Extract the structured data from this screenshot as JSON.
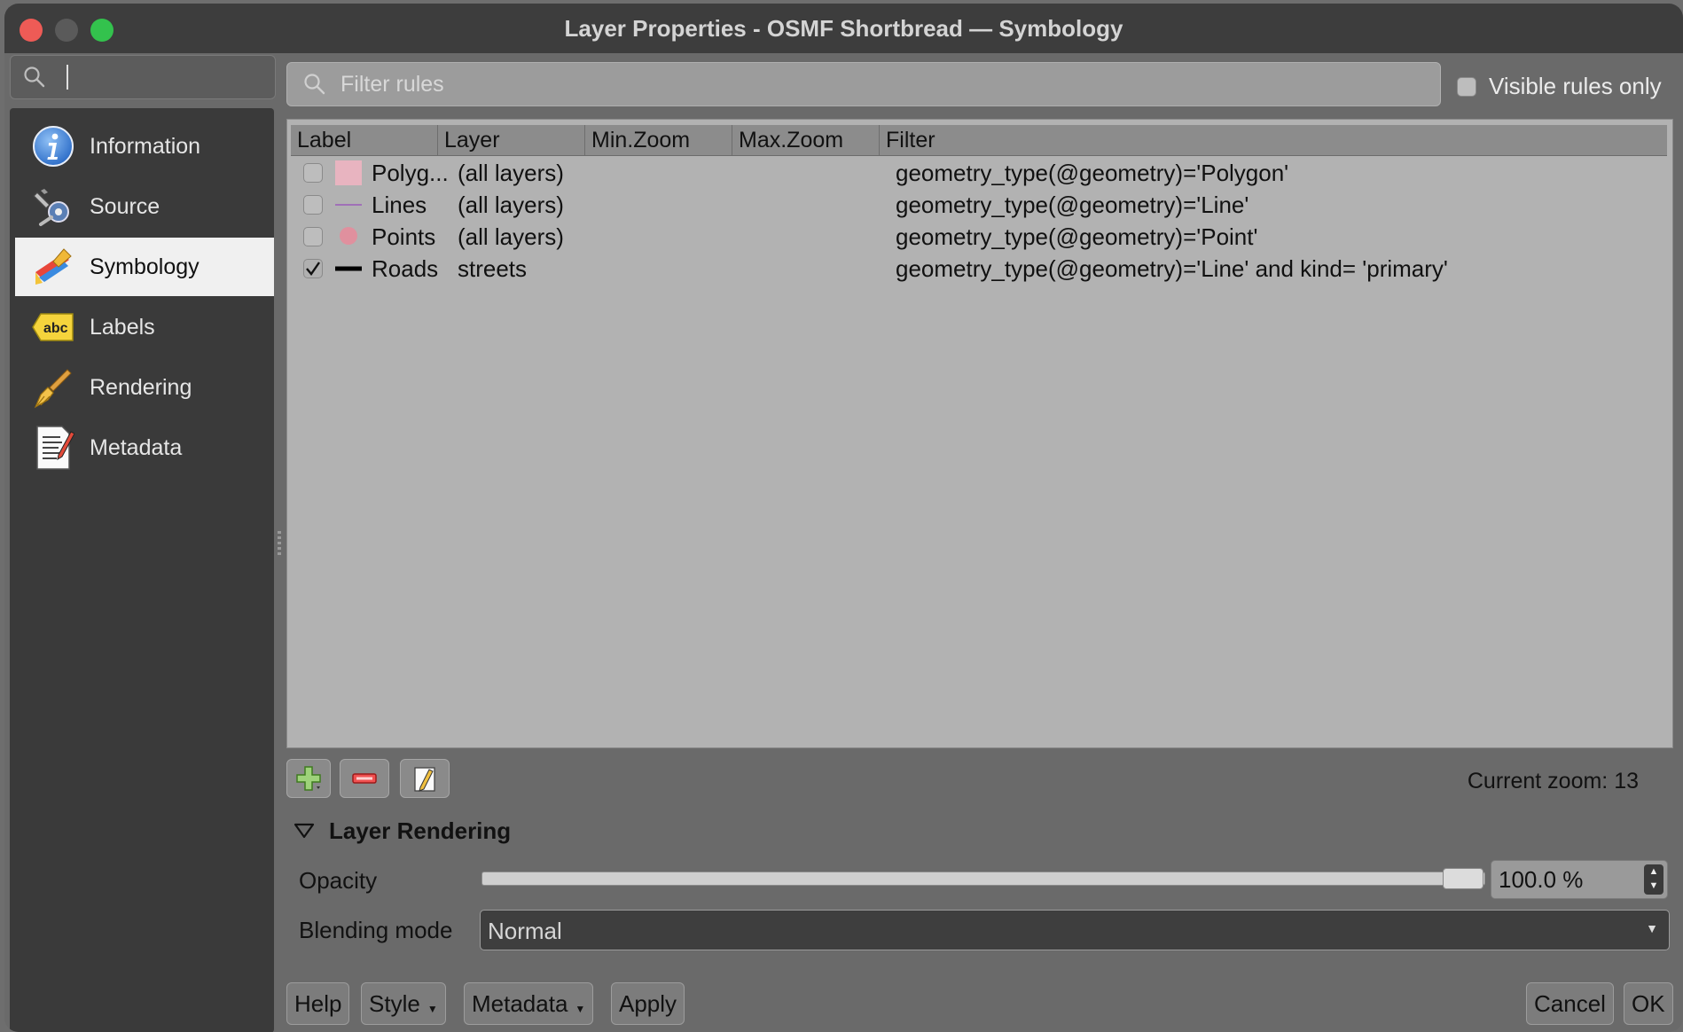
{
  "window": {
    "title": "Layer Properties - OSMF Shortbread — Symbology"
  },
  "sidebar": {
    "search_value": "",
    "items": [
      {
        "label": "Information",
        "icon": "info-icon",
        "active": false
      },
      {
        "label": "Source",
        "icon": "source-icon",
        "active": false
      },
      {
        "label": "Symbology",
        "icon": "symbology-icon",
        "active": true
      },
      {
        "label": "Labels",
        "icon": "labels-icon",
        "active": false
      },
      {
        "label": "Rendering",
        "icon": "rendering-icon",
        "active": false
      },
      {
        "label": "Metadata",
        "icon": "metadata-icon",
        "active": false
      }
    ]
  },
  "filter": {
    "placeholder": "Filter rules",
    "visible_rules_only": "Visible rules only",
    "visible_rules_checked": false
  },
  "table": {
    "columns": [
      "Label",
      "Layer",
      "Min.Zoom",
      "Max.Zoom",
      "Filter"
    ],
    "rows": [
      {
        "checked": false,
        "symbol": "polygon-fill",
        "symbol_color": "#e8b4c0",
        "label": "Polyg...",
        "layer": "(all layers)",
        "min_zoom": "",
        "max_zoom": "",
        "filter": "geometry_type(@geometry)='Polygon'"
      },
      {
        "checked": false,
        "symbol": "line",
        "symbol_color": "#a070b8",
        "label": "Lines",
        "layer": "(all layers)",
        "min_zoom": "",
        "max_zoom": "",
        "filter": "geometry_type(@geometry)='Line'"
      },
      {
        "checked": false,
        "symbol": "point",
        "symbol_color": "#e0909e",
        "label": "Points",
        "layer": "(all layers)",
        "min_zoom": "",
        "max_zoom": "",
        "filter": "geometry_type(@geometry)='Point'"
      },
      {
        "checked": true,
        "symbol": "thick-line",
        "symbol_color": "#000000",
        "label": "Roads",
        "layer": "streets",
        "min_zoom": "",
        "max_zoom": "",
        "filter": "geometry_type(@geometry)='Line' and kind= 'primary'"
      }
    ]
  },
  "toolbar": {
    "current_zoom": "Current zoom: 13"
  },
  "layer_rendering": {
    "title": "Layer Rendering",
    "opacity_label": "Opacity",
    "opacity_value": "100.0 %",
    "opacity_fraction": 1.0,
    "blending_label": "Blending mode",
    "blending_value": "Normal"
  },
  "buttons": {
    "help": "Help",
    "style": "Style",
    "metadata": "Metadata",
    "apply": "Apply",
    "cancel": "Cancel",
    "ok": "OK"
  }
}
